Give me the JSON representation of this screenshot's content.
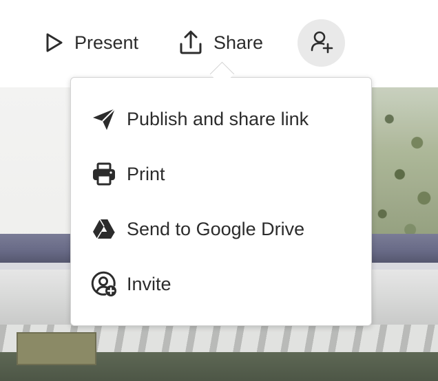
{
  "toolbar": {
    "present_label": "Present",
    "share_label": "Share",
    "icons": {
      "present": "play-outline-icon",
      "share": "share-upload-icon",
      "invite": "add-person-icon"
    }
  },
  "share_menu": {
    "items": [
      {
        "label": "Publish and share link",
        "icon": "paper-plane-icon"
      },
      {
        "label": "Print",
        "icon": "printer-icon"
      },
      {
        "label": "Send to Google Drive",
        "icon": "google-drive-icon"
      },
      {
        "label": "Invite",
        "icon": "user-add-circle-icon"
      }
    ]
  },
  "colors": {
    "text": "#2c2c2c",
    "invite_button_bg": "#e9e9e9",
    "menu_bg": "#ffffff",
    "menu_border": "#d3d3d3"
  }
}
